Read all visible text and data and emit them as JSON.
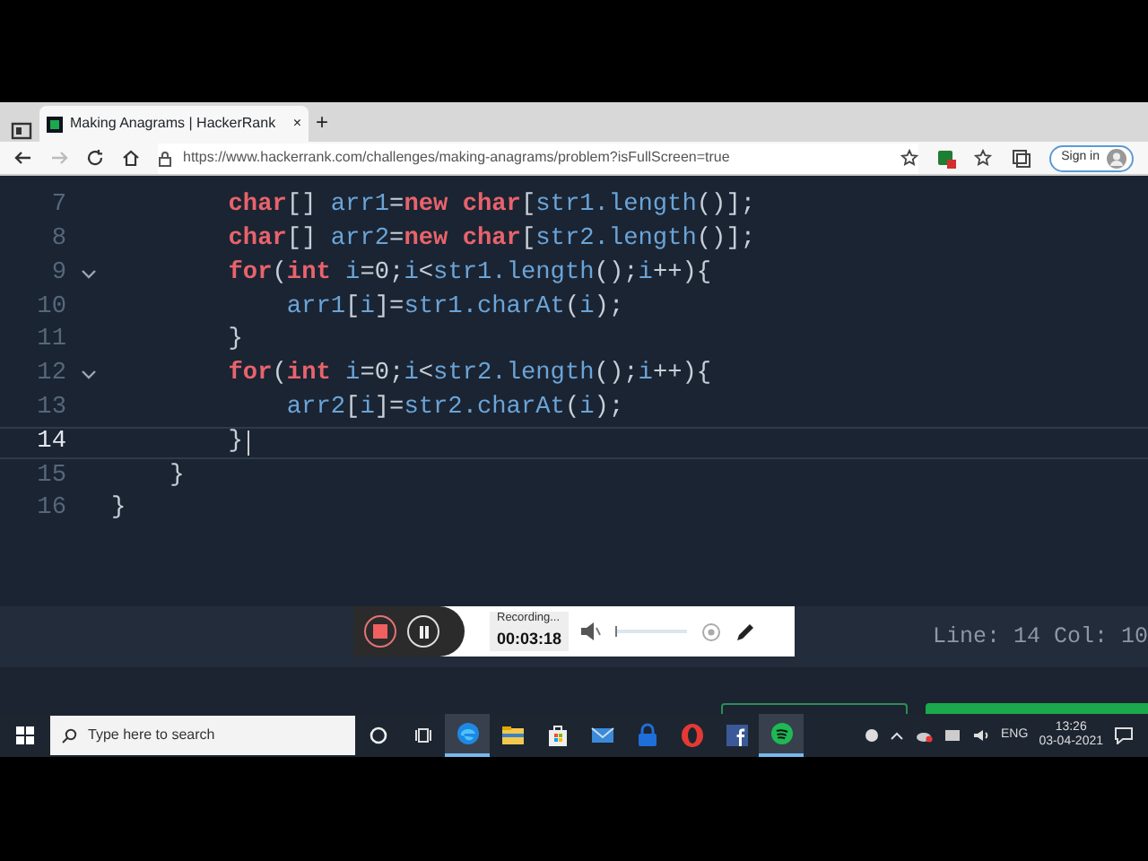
{
  "browser": {
    "tab": {
      "title": "Making Anagrams | HackerRank",
      "close": "×"
    },
    "new_tab": "+",
    "forward": {
      "disabled": true
    },
    "url": "https://www.hackerrank.com/challenges/making-anagrams/problem?isFullScreen=true",
    "sign_in": "Sign in"
  },
  "editor": {
    "lines": [
      {
        "number": "7",
        "fold": false,
        "current": false,
        "tokens": [
          {
            "kind": "kw",
            "text": "        char"
          },
          {
            "kind": "p",
            "text": "[] "
          },
          {
            "kind": "id",
            "text": "arr1"
          },
          {
            "kind": "p",
            "text": "="
          },
          {
            "kind": "kw",
            "text": "new char"
          },
          {
            "kind": "p",
            "text": "["
          },
          {
            "kind": "id",
            "text": "str1.length"
          },
          {
            "kind": "p",
            "text": "()];"
          }
        ]
      },
      {
        "number": "8",
        "fold": false,
        "current": false,
        "tokens": [
          {
            "kind": "kw",
            "text": "        char"
          },
          {
            "kind": "p",
            "text": "[] "
          },
          {
            "kind": "id",
            "text": "arr2"
          },
          {
            "kind": "p",
            "text": "="
          },
          {
            "kind": "kw",
            "text": "new char"
          },
          {
            "kind": "p",
            "text": "["
          },
          {
            "kind": "id",
            "text": "str2.length"
          },
          {
            "kind": "p",
            "text": "()];"
          }
        ]
      },
      {
        "number": "9",
        "fold": true,
        "current": false,
        "tokens": [
          {
            "kind": "kw",
            "text": "        for"
          },
          {
            "kind": "p",
            "text": "("
          },
          {
            "kind": "kw",
            "text": "int"
          },
          {
            "kind": "id",
            "text": " i"
          },
          {
            "kind": "p",
            "text": "=0;"
          },
          {
            "kind": "id",
            "text": "i"
          },
          {
            "kind": "p",
            "text": "<"
          },
          {
            "kind": "id",
            "text": "str1.length"
          },
          {
            "kind": "p",
            "text": "();"
          },
          {
            "kind": "id",
            "text": "i"
          },
          {
            "kind": "p",
            "text": "++){"
          }
        ]
      },
      {
        "number": "10",
        "fold": false,
        "current": false,
        "tokens": [
          {
            "kind": "id",
            "text": "            arr1"
          },
          {
            "kind": "p",
            "text": "["
          },
          {
            "kind": "id",
            "text": "i"
          },
          {
            "kind": "p",
            "text": "]="
          },
          {
            "kind": "id",
            "text": "str1.charAt"
          },
          {
            "kind": "p",
            "text": "("
          },
          {
            "kind": "id",
            "text": "i"
          },
          {
            "kind": "p",
            "text": ");"
          }
        ]
      },
      {
        "number": "11",
        "fold": false,
        "current": false,
        "tokens": [
          {
            "kind": "p",
            "text": "        }"
          }
        ]
      },
      {
        "number": "12",
        "fold": true,
        "current": false,
        "tokens": [
          {
            "kind": "kw",
            "text": "        for"
          },
          {
            "kind": "p",
            "text": "("
          },
          {
            "kind": "kw",
            "text": "int"
          },
          {
            "kind": "id",
            "text": " i"
          },
          {
            "kind": "p",
            "text": "=0;"
          },
          {
            "kind": "id",
            "text": "i"
          },
          {
            "kind": "p",
            "text": "<"
          },
          {
            "kind": "id",
            "text": "str2.length"
          },
          {
            "kind": "p",
            "text": "();"
          },
          {
            "kind": "id",
            "text": "i"
          },
          {
            "kind": "p",
            "text": "++){"
          }
        ]
      },
      {
        "number": "13",
        "fold": false,
        "current": false,
        "tokens": [
          {
            "kind": "id",
            "text": "            arr2"
          },
          {
            "kind": "p",
            "text": "["
          },
          {
            "kind": "id",
            "text": "i"
          },
          {
            "kind": "p",
            "text": "]="
          },
          {
            "kind": "id",
            "text": "str2.charAt"
          },
          {
            "kind": "p",
            "text": "("
          },
          {
            "kind": "id",
            "text": "i"
          },
          {
            "kind": "p",
            "text": ");"
          }
        ]
      },
      {
        "number": "14",
        "fold": false,
        "current": true,
        "tokens": [
          {
            "kind": "p",
            "text": "        }"
          }
        ]
      },
      {
        "number": "15",
        "fold": false,
        "current": false,
        "tokens": [
          {
            "kind": "p",
            "text": "    }"
          }
        ]
      },
      {
        "number": "16",
        "fold": false,
        "current": false,
        "tokens": [
          {
            "kind": "p",
            "text": "}"
          }
        ]
      }
    ],
    "status": "Line: 14 Col: 10"
  },
  "recorder": {
    "status": "Recording...",
    "time": "00:03:18"
  },
  "taskbar": {
    "search_placeholder": "Type here to search",
    "apps": [
      {
        "kind": "edge",
        "active": true
      },
      {
        "kind": "folder",
        "active": false
      },
      {
        "kind": "store",
        "active": false
      },
      {
        "kind": "mail",
        "active": false
      },
      {
        "kind": "lock",
        "active": false
      },
      {
        "kind": "opera",
        "active": false
      },
      {
        "kind": "facebook",
        "active": false
      },
      {
        "kind": "spotify",
        "active": true
      }
    ],
    "language": "ENG",
    "time": "13:26",
    "date": "03-04-2021"
  }
}
